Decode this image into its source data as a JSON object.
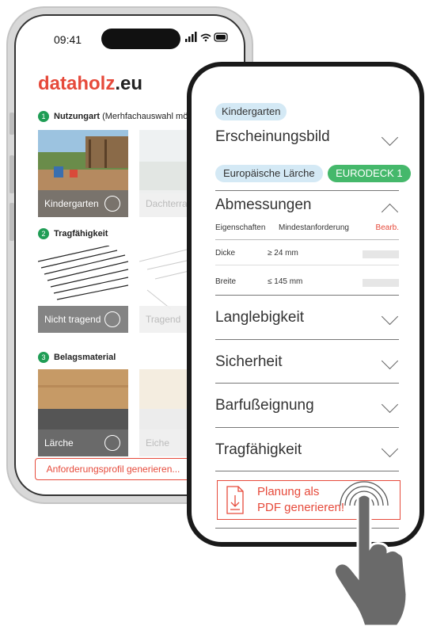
{
  "colors": {
    "accent": "#e64a3b",
    "green": "#1f9d55",
    "pill_blue": "#d4e9f5",
    "pill_green": "#45b86b"
  },
  "back_phone": {
    "status_time": "09:41",
    "brand_main": "dataholz",
    "brand_tld": ".eu",
    "sections": [
      {
        "num": "1",
        "title": "Nutzungart",
        "hint": "(Merhfachauswahl mögl"
      },
      {
        "num": "2",
        "title": "Tragfähigkeit",
        "hint": ""
      },
      {
        "num": "3",
        "title": "Belagsmaterial",
        "hint": ""
      }
    ],
    "tiles": [
      {
        "label": "Kindergarten",
        "selected": true
      },
      {
        "label": "Dachterras",
        "selected": false
      },
      {
        "label": "Nicht tragend",
        "selected": true
      },
      {
        "label": "Tragend",
        "selected": false
      },
      {
        "label": "Lärche",
        "selected": true
      },
      {
        "label": "Eiche",
        "selected": false
      }
    ],
    "generate_label": "Anforderungsprofil generieren..."
  },
  "front_phone": {
    "top_tag": "Kindergarten",
    "appearance_title": "Erscheinungsbild",
    "appearance_tags": [
      "Europäische Lärche",
      "EURODECK 1"
    ],
    "dimensions_title": "Abmessungen",
    "dims_header": {
      "col1": "Eigenschaften",
      "col2": "Mindestanforderung",
      "edit": "Bearb."
    },
    "dims_rows": [
      {
        "prop": "Dicke",
        "req": "≥ 24 mm"
      },
      {
        "prop": "Breite",
        "req": "≤ 145 mm"
      }
    ],
    "accordions": [
      "Langlebigkeit",
      "Sicherheit",
      "Barfußeignung",
      "Tragfähigkeit"
    ],
    "pdf_line1": "Planung als",
    "pdf_line2": "PDF generieren!"
  }
}
